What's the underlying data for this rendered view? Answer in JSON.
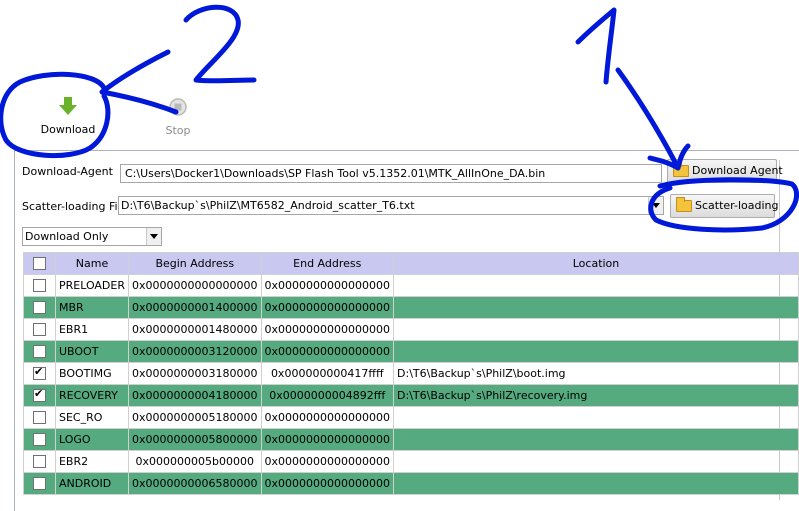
{
  "toolbar": {
    "download_label": "Download",
    "stop_label": "Stop"
  },
  "download_agent": {
    "label": "Download-Agent",
    "value": "C:\\Users\\Docker1\\Downloads\\SP Flash Tool v5.1352.01\\MTK_AllInOne_DA.bin",
    "button_label": "Download Agent"
  },
  "scatter": {
    "label": "Scatter-loading File",
    "value": "D:\\T6\\Backup`s\\PhilZ\\MT6582_Android_scatter_T6.txt",
    "button_label": "Scatter-loading"
  },
  "mode_select": {
    "value": "Download Only"
  },
  "table": {
    "headers": [
      "Name",
      "Begin Address",
      "End Address",
      "Location"
    ],
    "rows": [
      {
        "checked": false,
        "name": "PRELOADER",
        "begin": "0x0000000000000000",
        "end": "0x0000000000000000",
        "location": ""
      },
      {
        "checked": false,
        "name": "MBR",
        "begin": "0x0000000001400000",
        "end": "0x0000000000000000",
        "location": ""
      },
      {
        "checked": false,
        "name": "EBR1",
        "begin": "0x0000000001480000",
        "end": "0x0000000000000000",
        "location": ""
      },
      {
        "checked": false,
        "name": "UBOOT",
        "begin": "0x0000000003120000",
        "end": "0x0000000000000000",
        "location": ""
      },
      {
        "checked": true,
        "name": "BOOTIMG",
        "begin": "0x0000000003180000",
        "end": "0x000000000417ffff",
        "location": "D:\\T6\\Backup`s\\PhilZ\\boot.img"
      },
      {
        "checked": true,
        "name": "RECOVERY",
        "begin": "0x0000000004180000",
        "end": "0x0000000004892fff",
        "location": "D:\\T6\\Backup`s\\PhilZ\\recovery.img"
      },
      {
        "checked": false,
        "name": "SEC_RO",
        "begin": "0x0000000005180000",
        "end": "0x0000000000000000",
        "location": ""
      },
      {
        "checked": false,
        "name": "LOGO",
        "begin": "0x0000000005800000",
        "end": "0x0000000000000000",
        "location": ""
      },
      {
        "checked": false,
        "name": "EBR2",
        "begin": "0x000000005b00000",
        "end": "0x0000000000000000",
        "location": ""
      },
      {
        "checked": false,
        "name": "ANDROID",
        "begin": "0x0000000006580000",
        "end": "0x0000000000000000",
        "location": ""
      }
    ]
  },
  "annotations": {
    "label_2": "2",
    "label_1": "1"
  },
  "colors": {
    "row_alt": "#55ab7f",
    "header": "#c8c8f0",
    "ink": "#0018d8"
  }
}
